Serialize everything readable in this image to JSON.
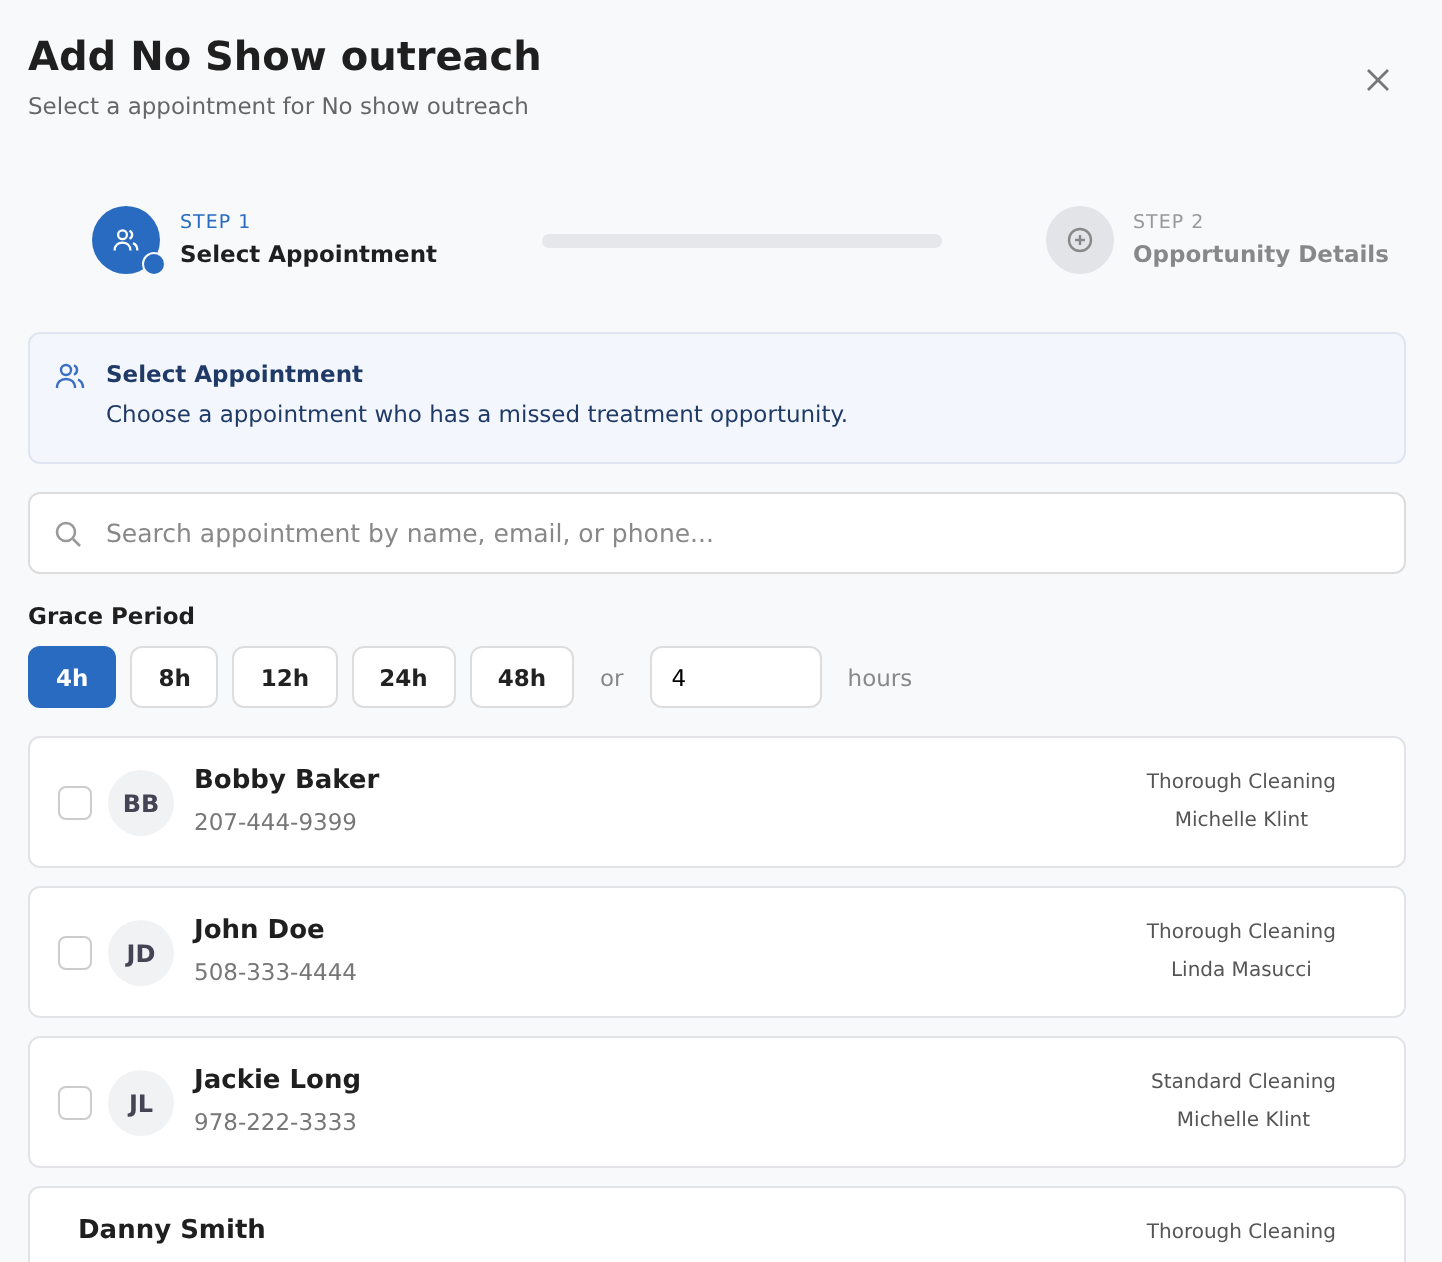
{
  "title": "Add No Show outreach",
  "subtitle": "Select a appointment for No show outreach",
  "steps": [
    {
      "step": "STEP 1",
      "label": "Select Appointment",
      "selected": true
    },
    {
      "step": "STEP 2",
      "label": "Opportunity Details",
      "selected": false
    }
  ],
  "info": {
    "title": "Select Appointment",
    "text": "Choose a appointment who has a missed treatment opportunity."
  },
  "search": {
    "placeholder": "Search appointment by name, email, or phone..."
  },
  "grace": {
    "label": "Grace Period",
    "options": [
      {
        "label": "4h",
        "selected": true
      },
      {
        "label": "8h",
        "selected": false
      },
      {
        "label": "12h",
        "selected": false
      },
      {
        "label": "24h",
        "selected": false
      },
      {
        "label": "48h",
        "selected": false
      }
    ],
    "or": "or",
    "value": "4",
    "unit": "hours"
  },
  "appointments": [
    {
      "initials": "BB",
      "name": "Bobby Baker",
      "phone": "207-444-9399",
      "treatment": "Thorough Cleaning",
      "provider": "Michelle Klint",
      "checked": false
    },
    {
      "initials": "JD",
      "name": "John Doe",
      "phone": "508-333-4444",
      "treatment": "Thorough Cleaning",
      "provider": "Linda Masucci",
      "checked": false
    },
    {
      "initials": "JL",
      "name": "Jackie Long",
      "phone": "978-222-3333",
      "treatment": "Standard Cleaning",
      "provider": "Michelle Klint",
      "checked": false
    },
    {
      "name": "Danny Smith",
      "treatment": "Thorough Cleaning"
    }
  ]
}
